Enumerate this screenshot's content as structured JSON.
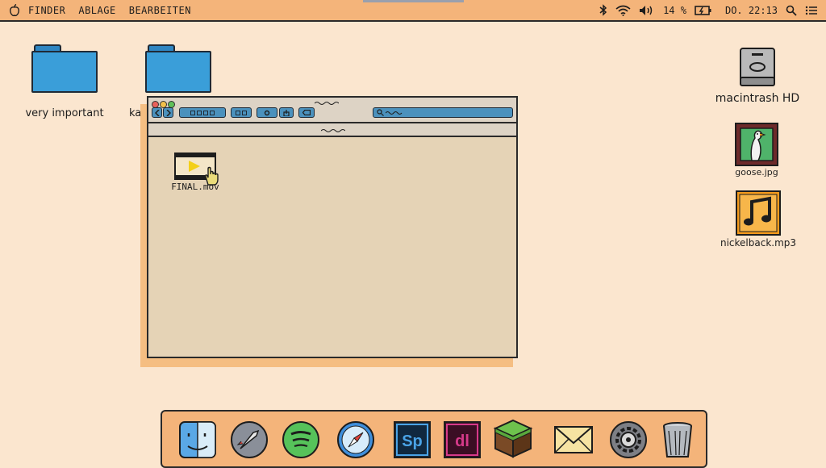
{
  "menubar": {
    "menus": [
      "FINDER",
      "ABLAGE",
      "BEARBEITEN"
    ],
    "battery_text": "14 %",
    "clock_text": "DO. 22:13",
    "icons": [
      "apple-icon",
      "bluetooth-icon",
      "wifi-icon",
      "volume-icon",
      "battery-charging-icon",
      "search-icon",
      "control-center-icon"
    ]
  },
  "desktop": {
    "folders": [
      {
        "label": "very important"
      },
      {
        "label": "ka"
      }
    ],
    "drive": {
      "label": "macintrash HD"
    },
    "files": [
      {
        "label": "goose.jpg"
      },
      {
        "label": "nickelback.mp3"
      }
    ]
  },
  "window": {
    "file": {
      "label": "FINAL.mov"
    }
  },
  "dock": {
    "apps": [
      "finder-icon",
      "launchpad-icon",
      "spotify-icon",
      "safari-icon",
      "photoshop-sp-icon",
      "dreamweaver-dl-icon",
      "minecraft-icon",
      "mail-icon",
      "system-preferences-icon",
      "trash-icon"
    ],
    "labels": {
      "photoshop": "Sp",
      "dreamweaver": "dl"
    }
  },
  "colors": {
    "menubar": "#f4b47a",
    "desktop": "#fbe6cf",
    "folder_blue": "#3a9ed9",
    "window_body": "#e5d3b6",
    "toolbar_blue": "#4b91bd"
  }
}
